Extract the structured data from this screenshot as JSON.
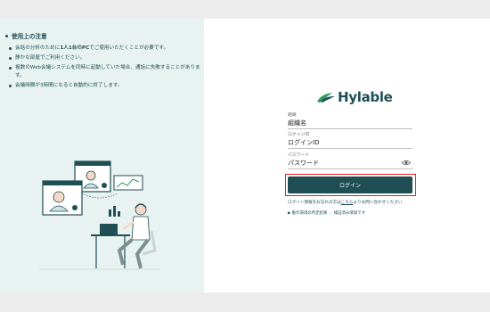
{
  "notes": {
    "title": "使用上の注意",
    "items": [
      {
        "pre": "会話の分析のために",
        "bold": "1人1台のPC",
        "post": "でご使用いただくことが必要です。"
      },
      {
        "pre": "静かな部屋でご利用ください。",
        "bold": "",
        "post": ""
      },
      {
        "pre": "複数のWeb会議システムを同時に起動していた場合、通話に失敗することがあります。",
        "bold": "",
        "post": ""
      },
      {
        "pre": "会議時間が3時間になると自動的に終了します。",
        "bold": "",
        "post": ""
      }
    ]
  },
  "logo": {
    "text": "Hylable"
  },
  "form": {
    "org_label": "組織",
    "org_value": "組織名",
    "login_id_label": "ログインID",
    "login_id_value": "ログインID",
    "password_label": "パスワード",
    "password_value": "パスワード",
    "login_button": "ログイン"
  },
  "help": {
    "pre": "ログイン情報をお忘れの方は",
    "link": "こちら",
    "post": "よりお問い合わせください"
  },
  "links": {
    "env_check": "▶ 動作環境の判定結果",
    "verified_env": "検証済み環境です"
  },
  "colors": {
    "brand": "#1f4e55",
    "accent_green": "#2e9e5b",
    "highlight": "#e01f24"
  }
}
